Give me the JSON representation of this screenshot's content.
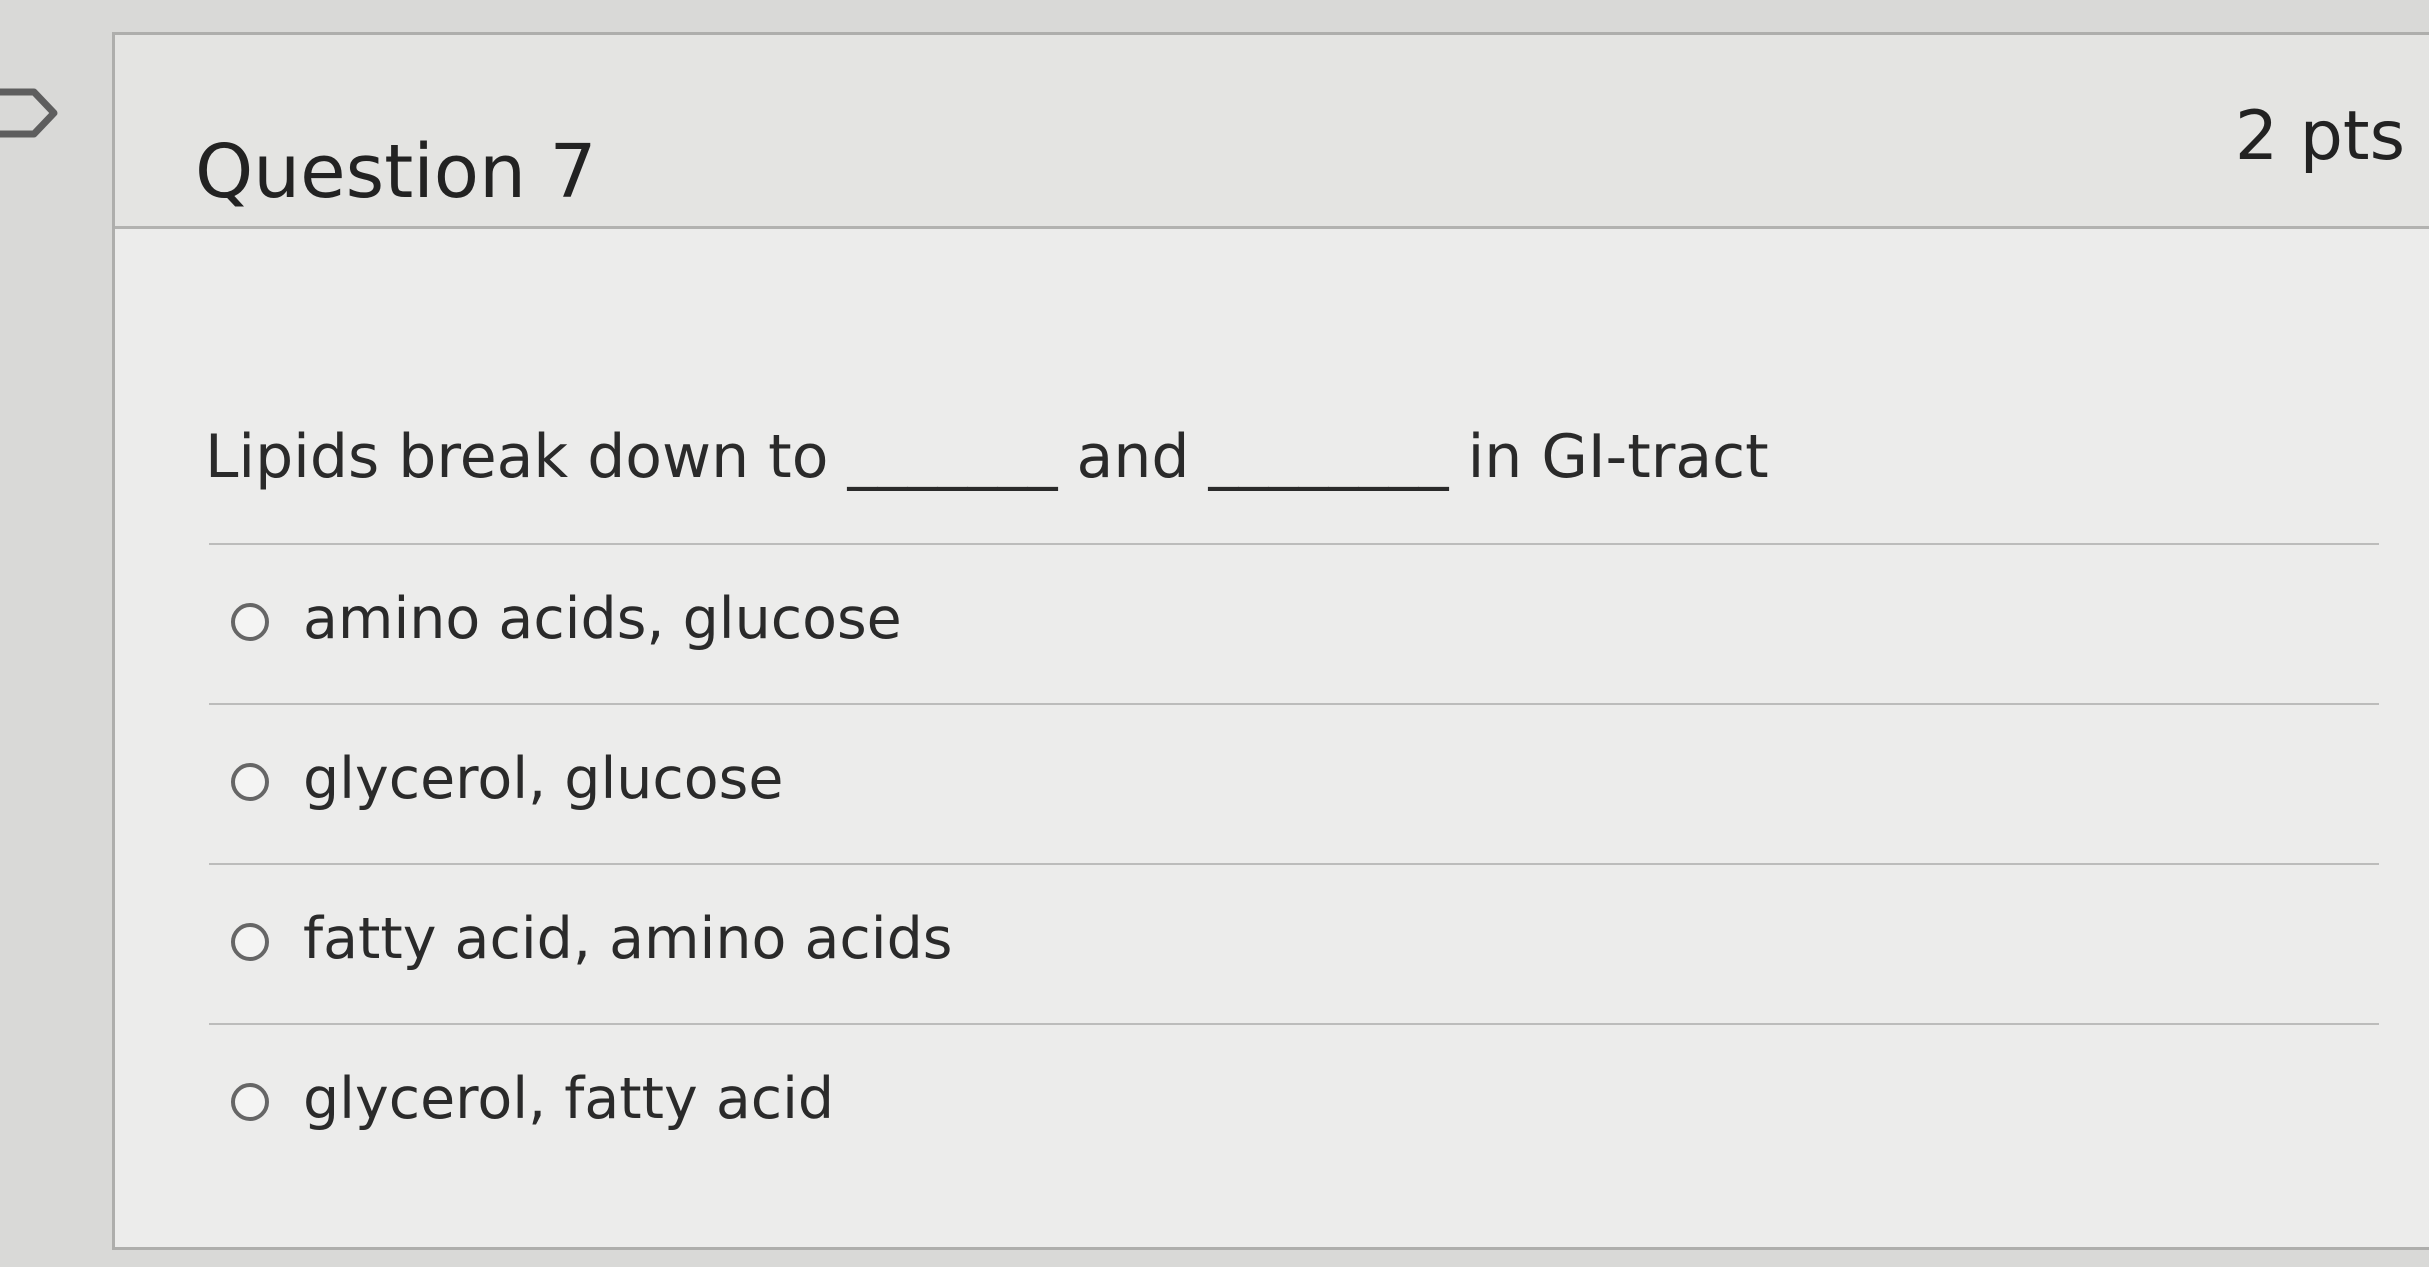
{
  "question": {
    "title": "Question 7",
    "points": "2 pts",
    "text": "Lipids break down to _______ and ________ in GI-tract",
    "answers": [
      "amino acids, glucose",
      "glycerol, glucose",
      "fatty acid, amino acids",
      "glycerol, fatty acid"
    ]
  },
  "colors": {
    "page_background": "#d9d9d7",
    "card_background": "#ececeb",
    "header_background": "#e4e4e2",
    "text": "#222222",
    "border": "#aeaeac"
  },
  "icons": {
    "flag": "flag-icon",
    "radio": "radio-button-icon"
  }
}
